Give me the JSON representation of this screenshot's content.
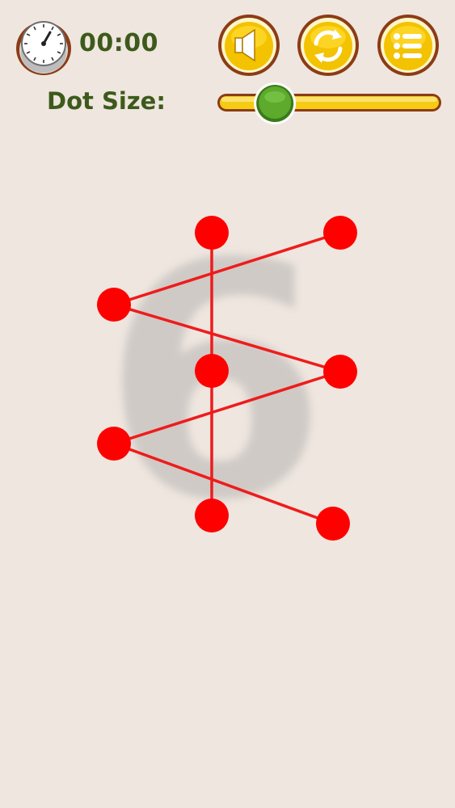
{
  "hud": {
    "timer": "00:00",
    "dot_size_label": "Dot Size:",
    "dot_size_value": 0.19
  },
  "buttons": [
    {
      "name": "sound-button",
      "icon": "speaker-icon"
    },
    {
      "name": "restart-button",
      "icon": "refresh-icon"
    },
    {
      "name": "menu-button",
      "icon": "list-icon"
    }
  ],
  "puzzle": {
    "target_glyph": "6",
    "colors": {
      "dot": "#ff0000",
      "line": "#ee1c1c",
      "glyph": "#cfcac6"
    }
  }
}
